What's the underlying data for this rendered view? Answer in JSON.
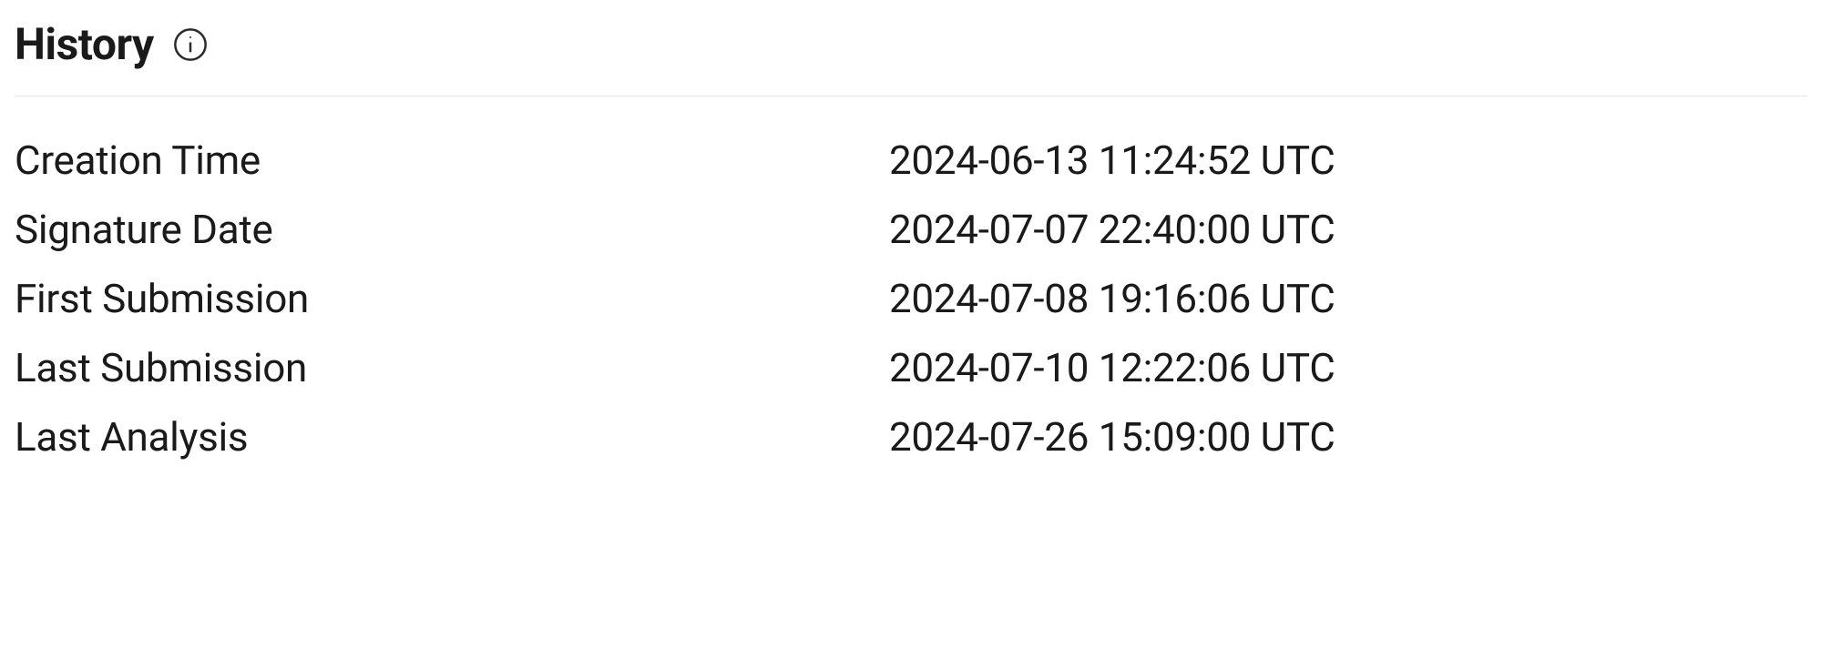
{
  "section": {
    "title": "History"
  },
  "history": {
    "rows": [
      {
        "label": "Creation Time",
        "value": "2024-06-13 11:24:52 UTC"
      },
      {
        "label": "Signature Date",
        "value": "2024-07-07 22:40:00 UTC"
      },
      {
        "label": "First Submission",
        "value": "2024-07-08 19:16:06 UTC"
      },
      {
        "label": "Last Submission",
        "value": "2024-07-10 12:22:06 UTC"
      },
      {
        "label": "Last Analysis",
        "value": "2024-07-26 15:09:00 UTC"
      }
    ]
  }
}
